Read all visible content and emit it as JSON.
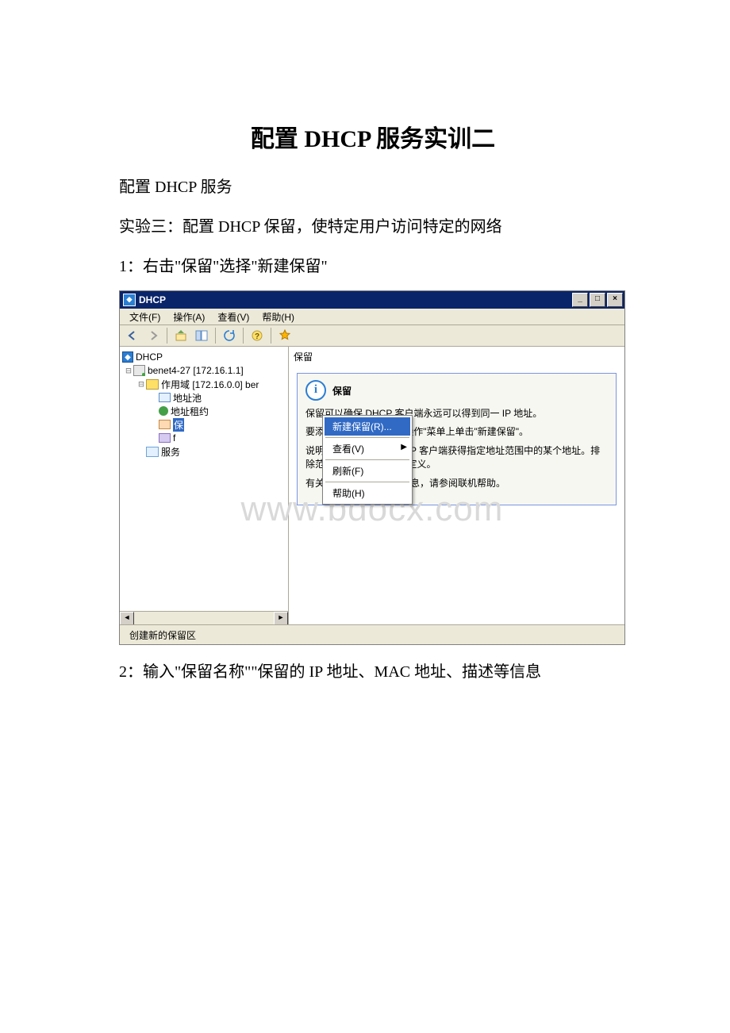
{
  "doc": {
    "title": "配置 DHCP 服务实训二",
    "line1": "配置 DHCP 服务",
    "line2": "实验三：配置 DHCP 保留，使特定用户访问特定的网络",
    "line3": "1：右击\"保留\"选择\"新建保留\"",
    "line4": "2：输入\"保留名称\"\"保留的 IP 地址、MAC 地址、描述等信息"
  },
  "watermark": "www.bdocx.com",
  "window": {
    "title": "DHCP",
    "menu": {
      "file": "文件(F)",
      "action": "操作(A)",
      "view": "查看(V)",
      "help": "帮助(H)"
    },
    "tree": {
      "root": "DHCP",
      "server": "benet4-27 [172.16.1.1]",
      "scope": "作用域 [172.16.0.0] ber",
      "pool": "地址池",
      "lease": "地址租约",
      "reservation_cut": "f",
      "options_folder": "服务"
    },
    "context_menu": {
      "new_reservation": "新建保留(R)...",
      "view": "查看(V)",
      "refresh": "刷新(F)",
      "help": "帮助(H)"
    },
    "detail": {
      "header": "保留",
      "info_title": "保留",
      "p1": "保留可以确保 DHCP 客户端永远可以得到同一 IP 地址。",
      "p2": "要添加一个保留，请在\"操作\"菜单上单击\"新建保留\"。",
      "p3": "说明: 排除可以防止 DHCP 客户端获得指定地址范围中的某个地址。排除范围可以在\"地址池\"中定义。",
      "p4": "有关保留和排除的详细信息，请参阅联机帮助。"
    },
    "status": "创建新的保留区"
  }
}
